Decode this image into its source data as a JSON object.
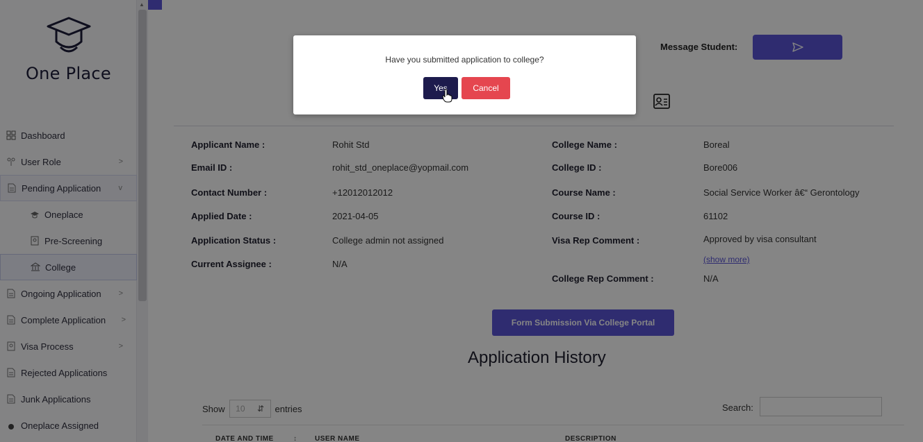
{
  "brand": {
    "name": "One Place"
  },
  "sidebar": {
    "items": [
      {
        "label": "Dashboard",
        "icon": "dashboard-icon",
        "chevron": ""
      },
      {
        "label": "User Role",
        "icon": "user-role-icon",
        "chevron": ">"
      },
      {
        "label": "Pending Application",
        "icon": "document-icon",
        "chevron": "v"
      },
      {
        "label": "Oneplace",
        "icon": "graduation-cap-icon",
        "chevron": ""
      },
      {
        "label": "Pre-Screening",
        "icon": "passport-icon",
        "chevron": ""
      },
      {
        "label": "College",
        "icon": "college-building-icon",
        "chevron": ""
      },
      {
        "label": "Ongoing Application",
        "icon": "document-icon",
        "chevron": ">"
      },
      {
        "label": "Complete Application",
        "icon": "document-icon",
        "chevron": ">"
      },
      {
        "label": "Visa Process",
        "icon": "passport-icon",
        "chevron": ">"
      },
      {
        "label": "Rejected Applications",
        "icon": "document-icon",
        "chevron": ""
      },
      {
        "label": "Junk Applications",
        "icon": "document-icon",
        "chevron": ""
      },
      {
        "label": "Oneplace Assigned",
        "icon": "dot-icon",
        "chevron": ""
      }
    ]
  },
  "header": {
    "message_label": "Message Student:"
  },
  "details": {
    "left": [
      {
        "label": "Applicant Name :",
        "value": "Rohit Std"
      },
      {
        "label": "Email ID :",
        "value": "rohit_std_oneplace@yopmail.com"
      },
      {
        "label": "Contact Number :",
        "value": "+12012012012"
      },
      {
        "label": "Applied Date :",
        "value": "2021-04-05"
      },
      {
        "label": "Application Status :",
        "value": "College admin not assigned"
      },
      {
        "label": "Current Assignee :",
        "value": "N/A"
      }
    ],
    "right": [
      {
        "label": "College Name :",
        "value": "Boreal"
      },
      {
        "label": "College ID :",
        "value": "Bore006"
      },
      {
        "label": "Course Name :",
        "value": "Social Service Worker â€“ Gerontology"
      },
      {
        "label": "Course ID :",
        "value": "61102"
      },
      {
        "label": "Visa Rep Comment :",
        "value": "Approved by visa consultant"
      },
      {
        "label": "College Rep Comment :",
        "value": "N/A"
      }
    ],
    "show_more": "(show more)"
  },
  "actions": {
    "portal_button": "Form Submission Via College Portal"
  },
  "history": {
    "title": "Application History",
    "show_label": "Show",
    "entries_value": "10",
    "entries_label": "entries",
    "search_label": "Search:",
    "columns": [
      "DATE AND TIME",
      "USER NAME",
      "DESCRIPTION"
    ]
  },
  "modal": {
    "question": "Have you submitted application to college?",
    "yes_label": "Yes",
    "cancel_label": "Cancel"
  },
  "colors": {
    "accent": "#5a55d6",
    "dark": "#1d1b4d",
    "danger": "#e5464f"
  }
}
